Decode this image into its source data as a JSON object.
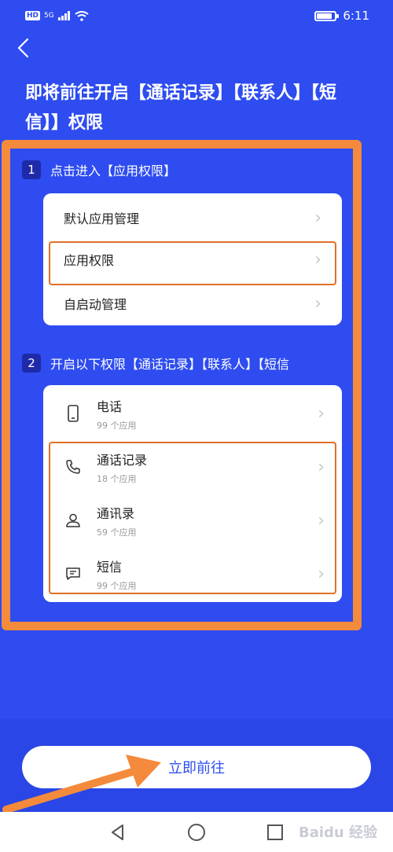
{
  "status": {
    "hd": "HD",
    "signal": "5G",
    "time": "6:11",
    "battery_pct": 85
  },
  "title": "即将前往开启【通话记录】【联系人】【短信】】权限",
  "step1": {
    "num": "1",
    "label": "点击进入【应用权限】",
    "items": [
      "默认应用管理",
      "应用权限",
      "自启动管理"
    ]
  },
  "step2": {
    "num": "2",
    "label": "开启以下权限【通话记录】【联系人】【短信",
    "permissions": [
      {
        "name": "电话",
        "count": "99 个应用",
        "icon": "phone-device-icon"
      },
      {
        "name": "通话记录",
        "count": "18 个应用",
        "icon": "call-log-icon"
      },
      {
        "name": "通讯录",
        "count": "59 个应用",
        "icon": "contacts-icon"
      },
      {
        "name": "短信",
        "count": "99 个应用",
        "icon": "message-icon"
      }
    ]
  },
  "button": {
    "label": "立即前往"
  },
  "watermark": "Baidu 经验",
  "colors": {
    "background": "#2e4cf0",
    "annotation": "#f48a3c",
    "card": "#ffffff"
  }
}
